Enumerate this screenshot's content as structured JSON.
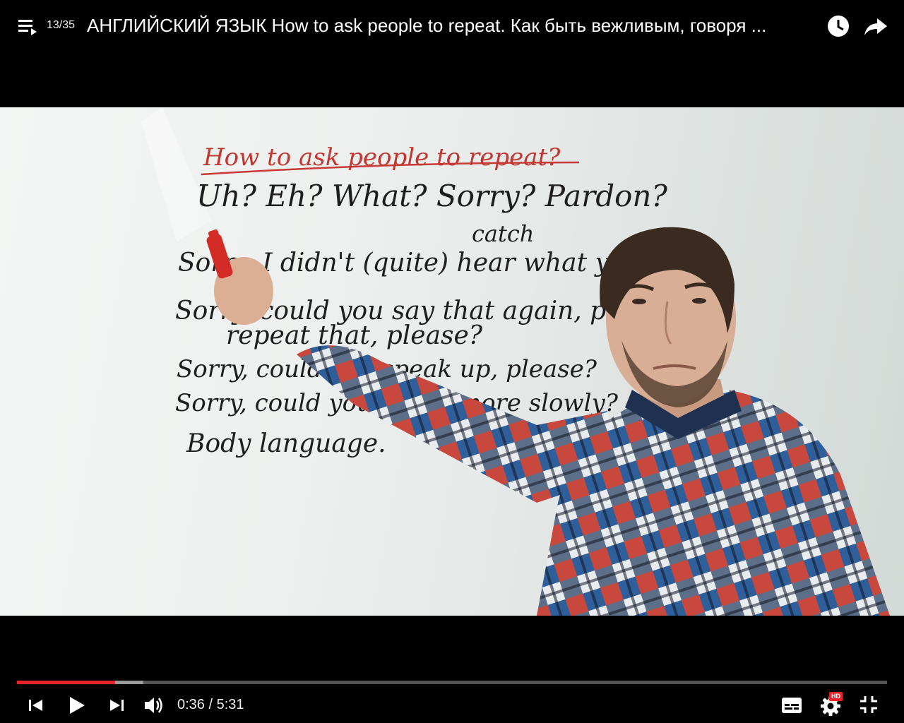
{
  "header": {
    "playlist_counter": "13/35",
    "title": "АНГЛИЙСКИЙ ЯЗЫК How to ask people to repeat. Как быть вежливым, говоря ..."
  },
  "icons": [
    "playlist-icon",
    "watch-later-icon",
    "share-icon",
    "previous-icon",
    "play-icon",
    "next-icon",
    "volume-icon",
    "subtitles-icon",
    "settings-icon",
    "hd-badge",
    "exit-fullscreen-icon"
  ],
  "video": {
    "whiteboard": {
      "heading": "How to ask people to repeat?",
      "lines": [
        "Uh? Eh? What? Sorry? Pardon?",
        "catch",
        "Sorry, I didn't (quite) hear what you",
        "Sorry, could you say that again, p",
        "repeat that, please?",
        "Sorry, could you speak up, please?",
        "Sorry, could you speak more slowly?",
        "Body language."
      ]
    }
  },
  "player": {
    "progress_fraction": 0.113,
    "buffered_fraction": 0.145,
    "current_time": "0:36",
    "separator": " / ",
    "duration": "5:31",
    "hd_label": "HD",
    "colors": {
      "played": "#e8242a",
      "buffer": "#9a9a9a",
      "track": "#555555",
      "hd_badge": "#e8242a"
    }
  }
}
